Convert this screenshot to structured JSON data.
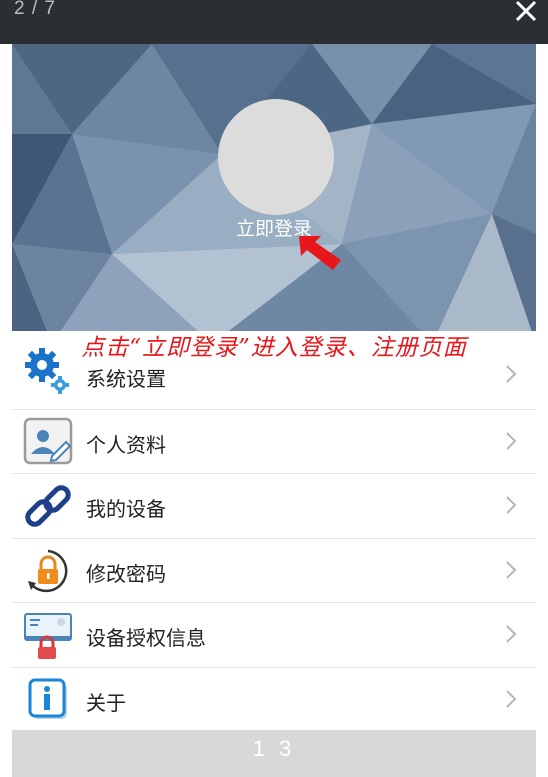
{
  "viewer": {
    "counter": "2 / 7",
    "page_numbers": "1 3"
  },
  "profile": {
    "login_label": "立即登录"
  },
  "annotation": {
    "text": "点击“立即登录”进入登录、注册页面"
  },
  "menu": {
    "items": [
      {
        "label": "系统设置",
        "icon": "gears-icon"
      },
      {
        "label": "个人资料",
        "icon": "profile-card-icon"
      },
      {
        "label": "我的设备",
        "icon": "chain-link-icon"
      },
      {
        "label": "修改密码",
        "icon": "padlock-refresh-icon"
      },
      {
        "label": "设备授权信息",
        "icon": "device-auth-lock-icon"
      },
      {
        "label": "关于",
        "icon": "info-icon"
      }
    ]
  },
  "colors": {
    "annotation_red": "#e8171b",
    "header_blue": "#5a7290",
    "topbar": "#2b2f33"
  }
}
